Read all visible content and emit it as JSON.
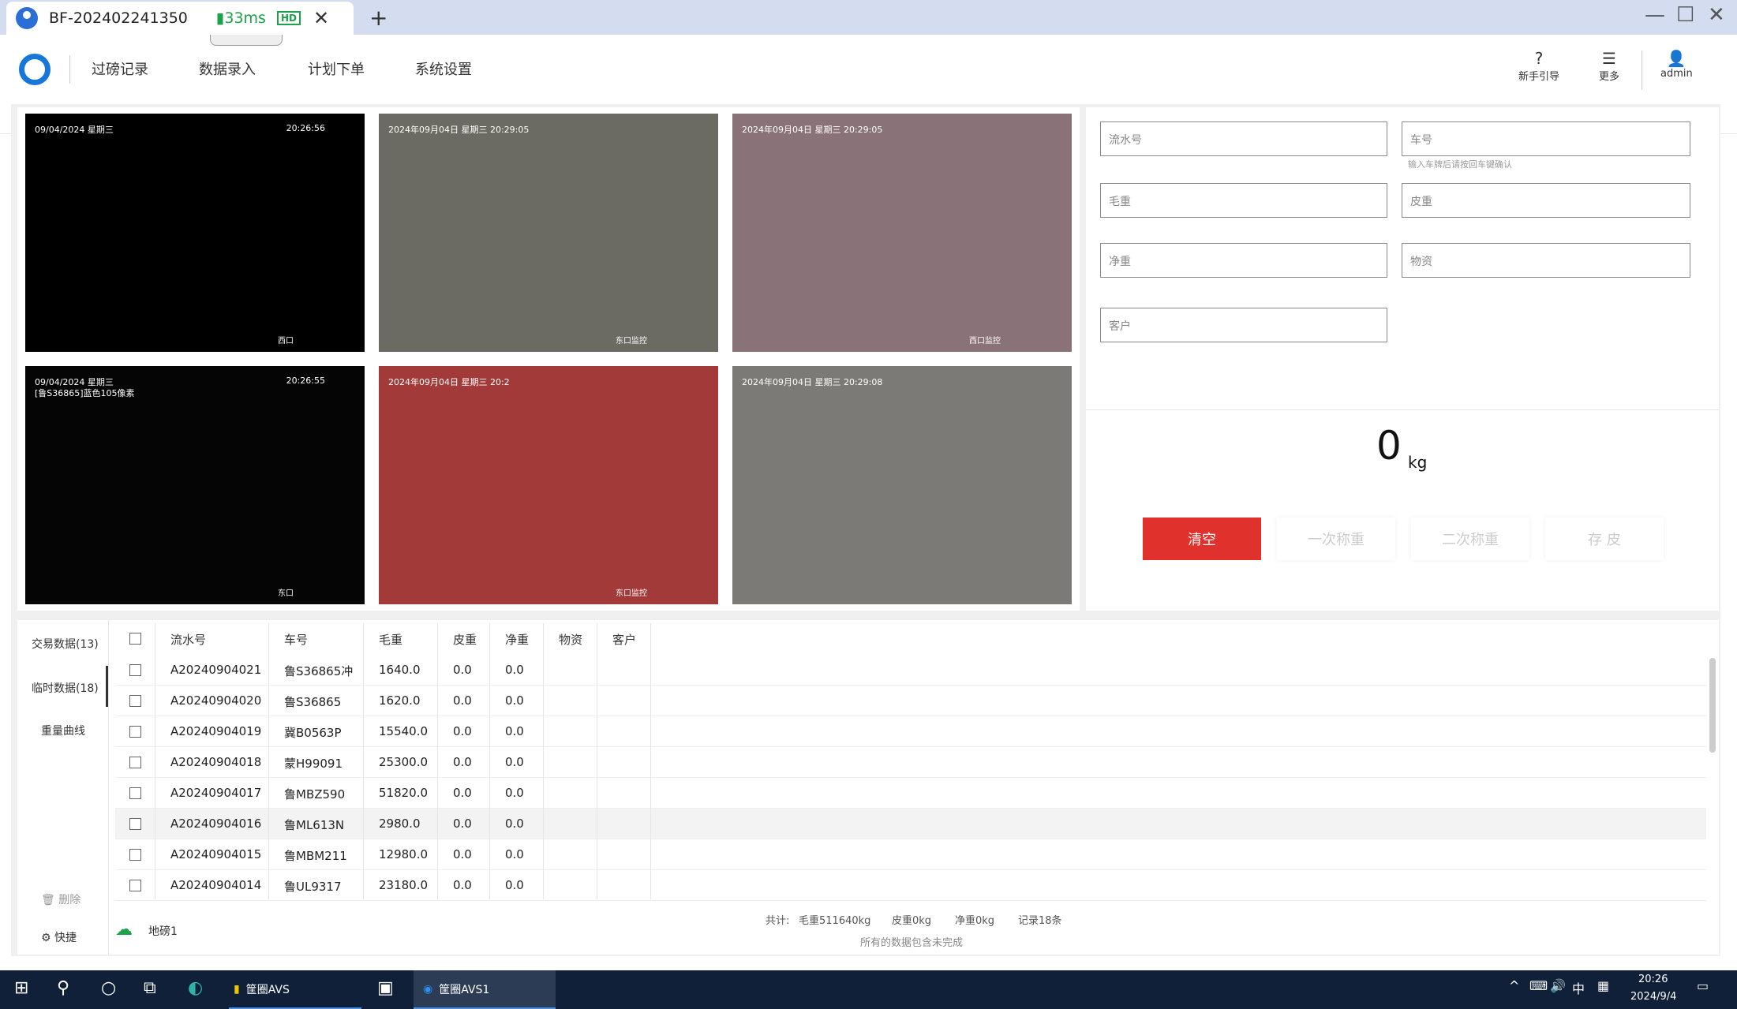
{
  "tab": {
    "title": "BF-202402241350",
    "signal": "33ms",
    "hd": "HD",
    "close": "✕",
    "new": "+"
  },
  "nav": {
    "items": [
      "过磅记录",
      "数据录入",
      "计划下单",
      "系统设置"
    ],
    "help": "新手引导",
    "more": "更多",
    "user": "admin"
  },
  "cams": [
    {
      "ts": "09/04/2024 星期三",
      "time": "20:26:56",
      "label": "西口",
      "bg": "#000000"
    },
    {
      "ts": "2024年09月04日 星期三 20:29:05",
      "time": "",
      "label": "东口监控",
      "bg": "#6b6b63"
    },
    {
      "ts": "2024年09月04日 星期三 20:29:05",
      "time": "",
      "label": "西口监控",
      "bg": "#8a7378"
    },
    {
      "ts": "09/04/2024 星期三",
      "ts_line2": "[鲁S36865]蓝色105像素",
      "time": "20:26:55",
      "label": "东口",
      "bg": "#050505"
    },
    {
      "ts": "2024年09月04日 星期三 20:2",
      "time": "",
      "label": "东口监控",
      "bg": "#a33a3a"
    },
    {
      "ts": "2024年09月04日 星期三 20:29:08",
      "time": "",
      "label": "",
      "bg": "#7c7a77"
    }
  ],
  "form": {
    "serial_ph": "流水号",
    "plate_ph": "车号",
    "plate_hint": "输入车牌后请按回车键确认",
    "gross_ph": "毛重",
    "tare_ph": "皮重",
    "net_ph": "净重",
    "goods_ph": "物资",
    "customer_ph": "客户"
  },
  "weight": {
    "value": "0",
    "unit": "kg"
  },
  "buttons": {
    "clear": "清空",
    "first": "一次称重",
    "second": "二次称重",
    "save": "存 皮"
  },
  "side": {
    "trade": "交易数据(13)",
    "temp": "临时数据(18)",
    "curve": "重量曲线",
    "delete": "删除",
    "shortcut": "快捷"
  },
  "table": {
    "headers": [
      "流水号",
      "车号",
      "毛重",
      "皮重",
      "净重",
      "物资",
      "客户"
    ],
    "rows": [
      [
        "A20240904021",
        "鲁S36865冲",
        "1640.0",
        "0.0",
        "0.0"
      ],
      [
        "A20240904020",
        "鲁S36865",
        "1620.0",
        "0.0",
        "0.0"
      ],
      [
        "A20240904019",
        "冀B0563P",
        "15540.0",
        "0.0",
        "0.0"
      ],
      [
        "A20240904018",
        "蒙H99091",
        "25300.0",
        "0.0",
        "0.0"
      ],
      [
        "A20240904017",
        "鲁MBZ590",
        "51820.0",
        "0.0",
        "0.0"
      ],
      [
        "A20240904016",
        "鲁ML613N",
        "2980.0",
        "0.0",
        "0.0"
      ],
      [
        "A20240904015",
        "鲁MBM211",
        "12980.0",
        "0.0",
        "0.0"
      ],
      [
        "A20240904014",
        "鲁UL9317",
        "23180.0",
        "0.0",
        "0.0"
      ]
    ]
  },
  "footer": {
    "scale": "地磅1",
    "total": "共计:",
    "gross": "毛重511640kg",
    "tare": "皮重0kg",
    "net": "净重0kg",
    "count": "记录18条",
    "note": "所有的数据包含未完成"
  },
  "taskbar": {
    "app1": "筐圈AVS",
    "app2": "筐圈AVS1",
    "time": "20:26",
    "date": "2024/9/4",
    "ime": "中"
  }
}
